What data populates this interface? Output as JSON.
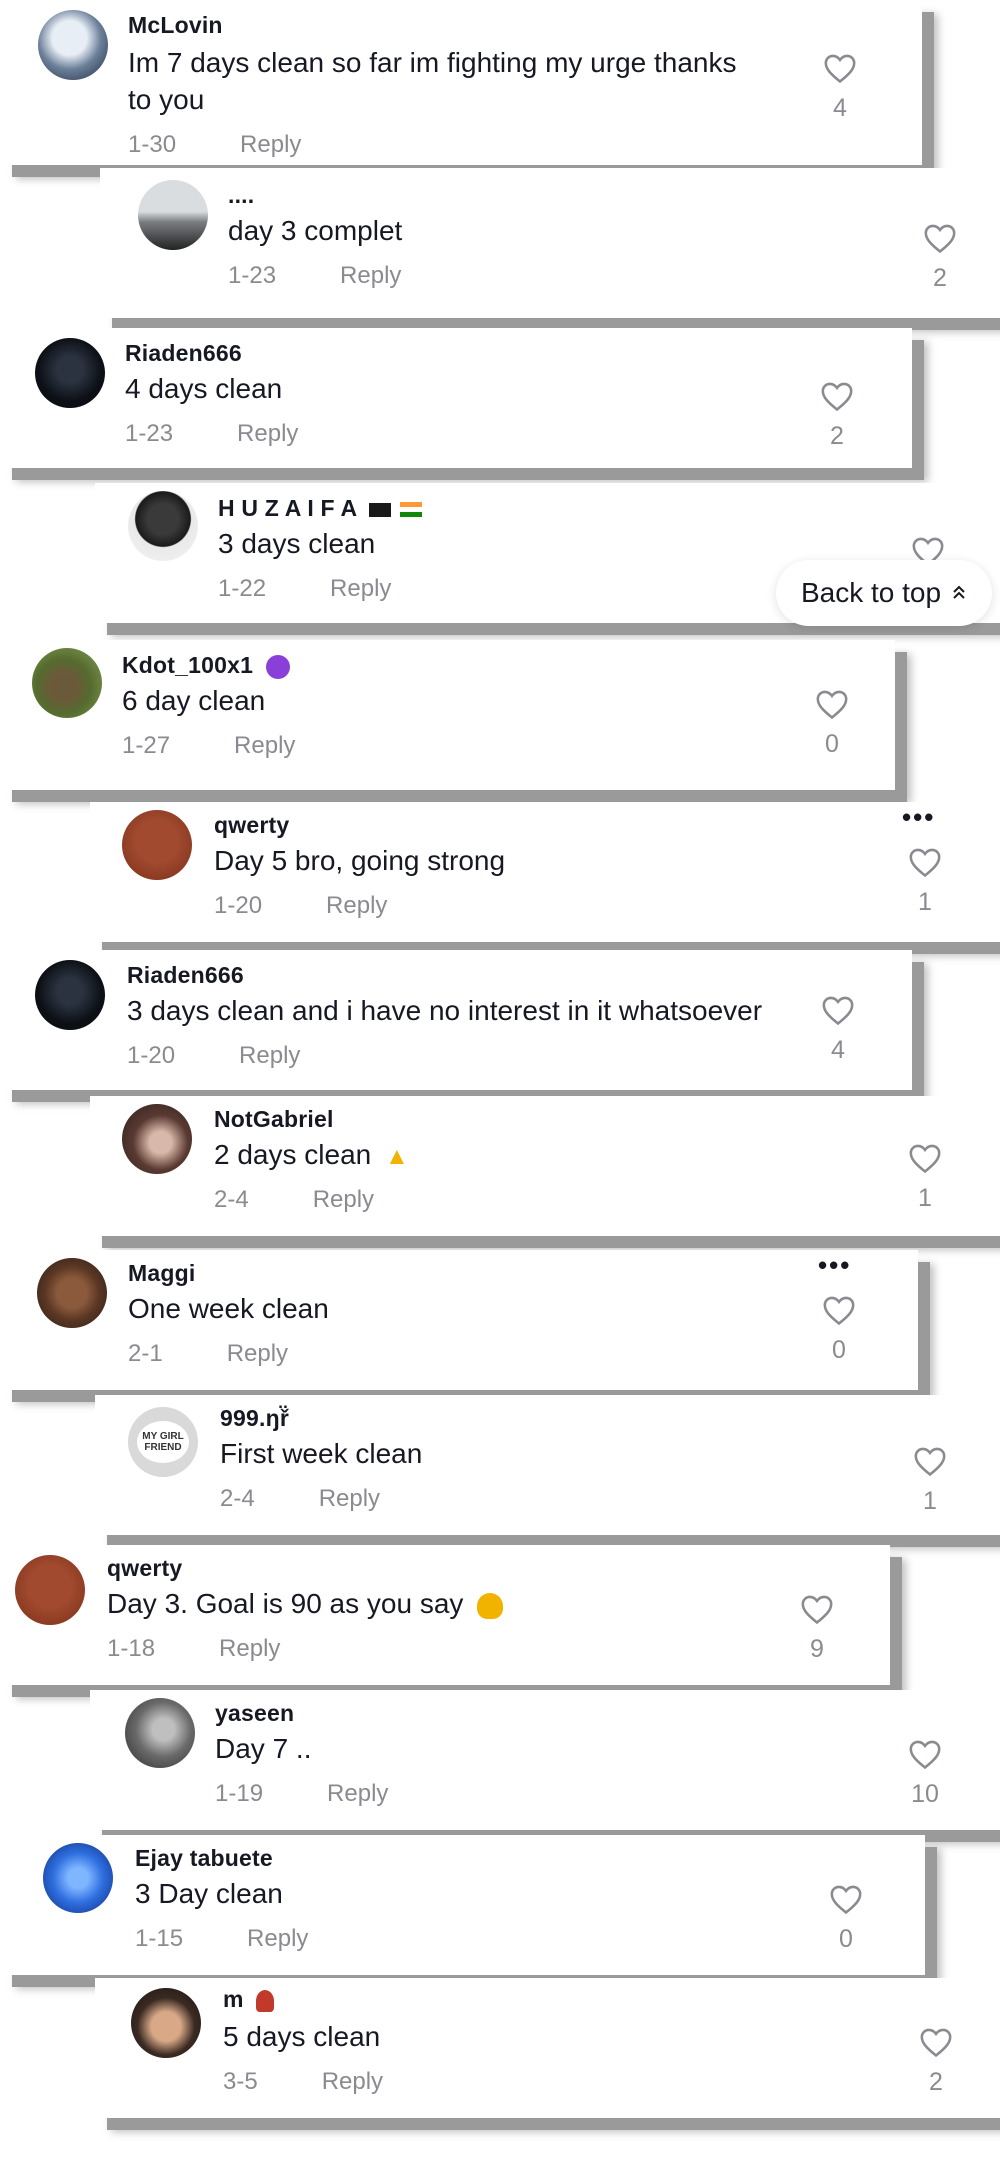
{
  "back_to_top": {
    "label": "Back to top"
  },
  "comments": [
    {
      "username": "McLovin",
      "text_line1": "Im 7 days clean so far im fighting my urge thanks",
      "text_line2": "to you",
      "date": "1-30",
      "reply": "Reply",
      "likes": "4"
    },
    {
      "username": "....",
      "text": "day 3 complet",
      "date": "1-23",
      "reply": "Reply",
      "likes": "2"
    },
    {
      "username": "Riaden666",
      "text": "4 days clean",
      "date": "1-23",
      "reply": "Reply",
      "likes": "2"
    },
    {
      "username": "H U Z A I F A",
      "text": "3 days clean",
      "date": "1-22",
      "reply": "Reply",
      "likes": ""
    },
    {
      "username": "Kdot_100x1",
      "text": "6 day clean",
      "date": "1-27",
      "reply": "Reply",
      "likes": "0"
    },
    {
      "username": "qwerty",
      "text": "Day 5 bro, going strong",
      "date": "1-20",
      "reply": "Reply",
      "likes": "1"
    },
    {
      "username": "Riaden666",
      "text": "3 days clean and i have no interest in it whatsoever",
      "date": "1-20",
      "reply": "Reply",
      "likes": "4"
    },
    {
      "username": "NotGabriel",
      "text": "2 days clean",
      "date": "2-4",
      "reply": "Reply",
      "likes": "1"
    },
    {
      "username": "Maggi",
      "text": "One week clean",
      "date": "2-1",
      "reply": "Reply",
      "likes": "0"
    },
    {
      "username": "999.ŋř̈",
      "text": "First week clean",
      "date": "2-4",
      "reply": "Reply",
      "likes": "1"
    },
    {
      "username": "qwerty",
      "text": "Day 3. Goal is 90 as you say",
      "date": "1-18",
      "reply": "Reply",
      "likes": "9"
    },
    {
      "username": "yaseen",
      "text": "Day 7 ..",
      "date": "1-19",
      "reply": "Reply",
      "likes": "10"
    },
    {
      "username": "Ejay tabuete",
      "text": "3 Day clean",
      "date": "1-15",
      "reply": "Reply",
      "likes": "0"
    },
    {
      "username": "m",
      "text": "5 days clean",
      "date": "3-5",
      "reply": "Reply",
      "likes": "2"
    }
  ],
  "avatar_badge_text": "MY GIRL FRIEND",
  "colors": {
    "text": "#161823",
    "muted": "#8a8b91",
    "card_shadow": "#9a9a9a",
    "qwerty_avatar": "#8b3a23"
  }
}
